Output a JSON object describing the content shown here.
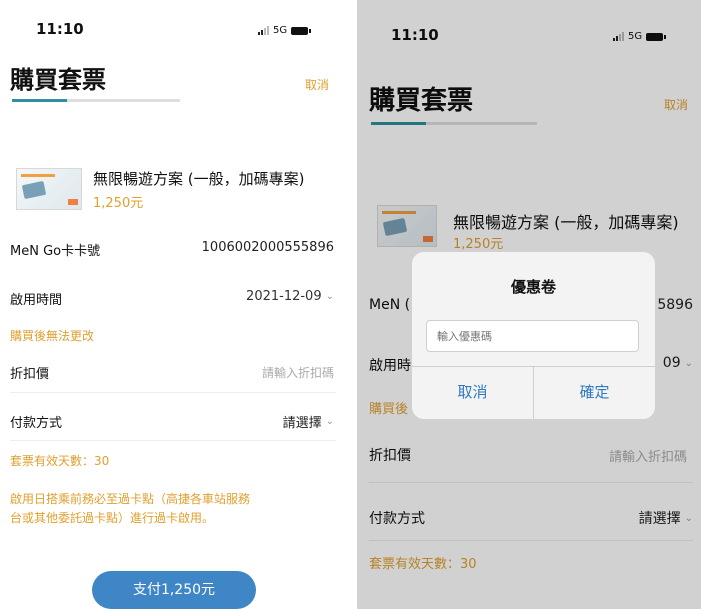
{
  "status_bar": {
    "time": "11:10",
    "network": "5G"
  },
  "header": {
    "title": "購買套票",
    "cancel_label": "取消",
    "progress_fraction": 0.33
  },
  "product": {
    "name": "無限暢遊方案 (一般，加碼專案)",
    "price": "1,250元",
    "image_icon": "ticket-card-image"
  },
  "form": {
    "card_label": "MeN Go卡卡號",
    "card_value": "1006002000555896",
    "start_label": "啟用時間",
    "start_value": "2021-12-09",
    "start_note": "購買後無法更改",
    "discount_label": "折扣價",
    "discount_placeholder": "請輸入折扣碼",
    "payment_label": "付款方式",
    "payment_value": "請選擇",
    "valid_days": "套票有效天數：30",
    "notice": "啟用日搭乘前務必至過卡點（高捷各車站服務台或其他委託過卡點）進行過卡啟用。",
    "notice_line1": "啟用日搭乘前務必至過卡點（高捷各車站服務",
    "notice_line2": "台或其他委託過卡點）進行過卡啟用。"
  },
  "pay_button_label": "支付1,250元",
  "right_partial": {
    "card_label": "MeN (",
    "card_value": "5896",
    "start_label": "啟用時",
    "start_value": "09",
    "start_note": "購買後"
  },
  "dialog": {
    "title": "優惠卷",
    "input_placeholder": "輸入優惠碼",
    "cancel_label": "取消",
    "confirm_label": "確定"
  },
  "colors": {
    "accent": "#e0a030",
    "primary_blue": "#3f86c6",
    "progress": "#2f8fa0",
    "dialog_button": "#2f7ac0"
  }
}
